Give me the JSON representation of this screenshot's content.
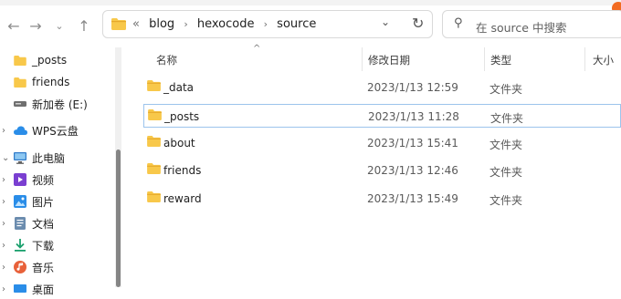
{
  "address": {
    "overflow": "«",
    "crumbs": [
      "blog",
      "hexocode",
      "source"
    ],
    "separator": "›"
  },
  "search": {
    "placeholder": "在 source 中搜索"
  },
  "sidebar": {
    "items": [
      {
        "label": "_posts",
        "icon": "folder-icon"
      },
      {
        "label": "friends",
        "icon": "folder-icon"
      },
      {
        "label": "新加卷 (E:)",
        "icon": "drive-icon"
      },
      {
        "label": "WPS云盘",
        "icon": "cloud-icon"
      },
      {
        "label": "此电脑",
        "icon": "computer-icon"
      },
      {
        "label": "视频",
        "icon": "video-icon"
      },
      {
        "label": "图片",
        "icon": "picture-icon"
      },
      {
        "label": "文档",
        "icon": "document-icon"
      },
      {
        "label": "下载",
        "icon": "download-icon"
      },
      {
        "label": "音乐",
        "icon": "music-icon"
      },
      {
        "label": "桌面",
        "icon": "desktop-icon"
      }
    ]
  },
  "columns": {
    "name": "名称",
    "date": "修改日期",
    "type": "类型",
    "size": "大小"
  },
  "files": [
    {
      "name": "_data",
      "date": "2023/1/13 12:59",
      "type": "文件夹",
      "selected": false
    },
    {
      "name": "_posts",
      "date": "2023/1/13 11:28",
      "type": "文件夹",
      "selected": true
    },
    {
      "name": "about",
      "date": "2023/1/13 15:41",
      "type": "文件夹",
      "selected": false
    },
    {
      "name": "friends",
      "date": "2023/1/13 12:46",
      "type": "文件夹",
      "selected": false
    },
    {
      "name": "reward",
      "date": "2023/1/13 15:49",
      "type": "文件夹",
      "selected": false
    }
  ],
  "colors": {
    "folder": "#f8c84a",
    "folder_dark": "#e6a92c",
    "selection_border": "#9cc4ec"
  }
}
